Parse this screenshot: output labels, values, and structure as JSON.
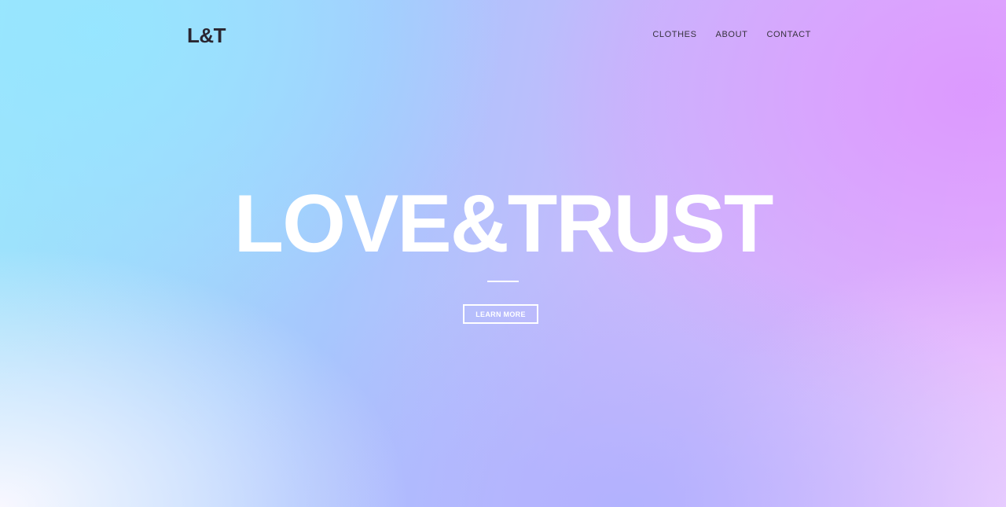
{
  "header": {
    "logo": "L&T",
    "nav": [
      {
        "label": "CLOTHES"
      },
      {
        "label": "ABOUT"
      },
      {
        "label": "CONTACT"
      }
    ]
  },
  "hero": {
    "title": "LOVE&TRUST",
    "button_label": "LEARN MORE"
  },
  "colors": {
    "text_dark": "#2a2631",
    "hero_text": "#ffffff",
    "gradient_cyan": "#9fe4fb",
    "gradient_violet": "#c6b9fc",
    "gradient_pink": "#e6b6fc"
  }
}
